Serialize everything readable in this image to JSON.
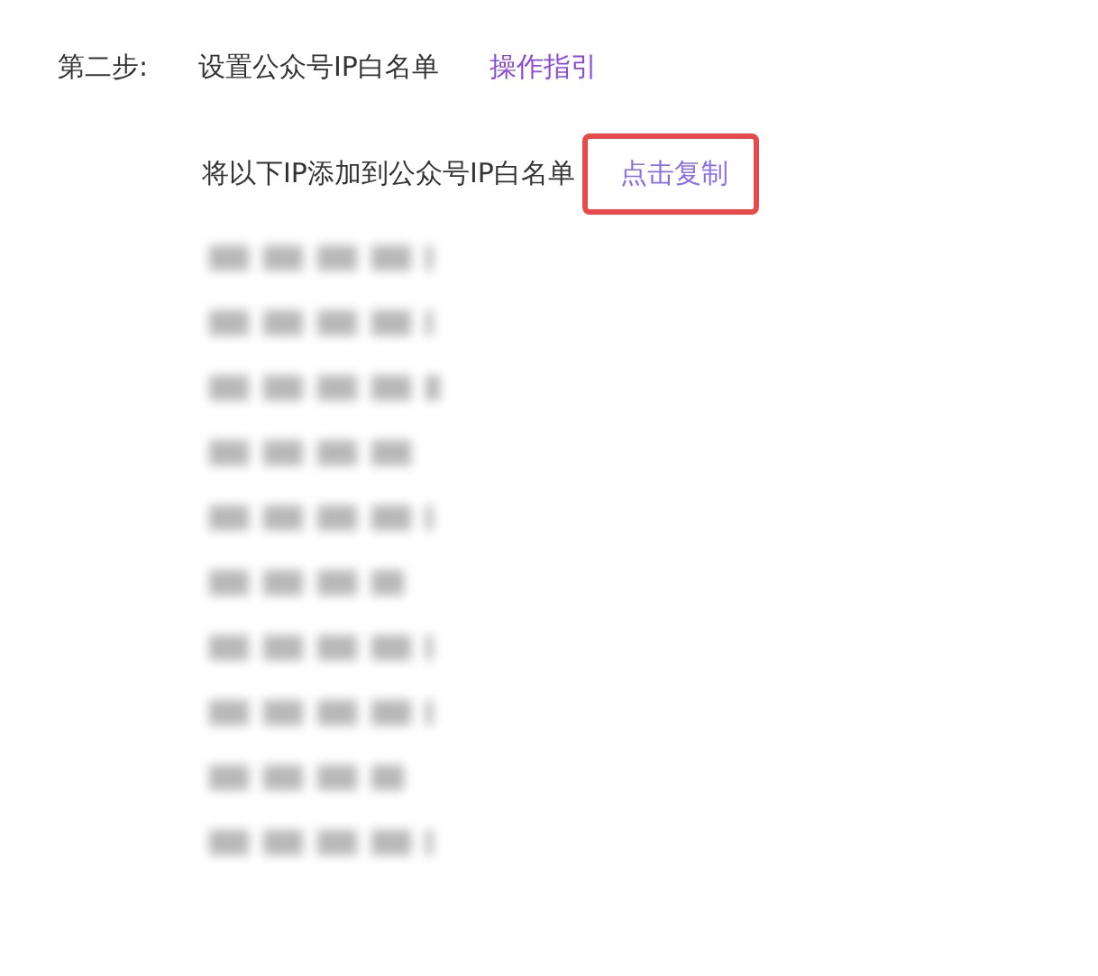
{
  "step": {
    "label": "第二步:",
    "title": "设置公众号IP白名单",
    "guide_link": "操作指引"
  },
  "instruction": {
    "text": "将以下IP添加到公众号IP白名单",
    "copy_link": "点击复制",
    "highlighted": true
  },
  "ip_list": [
    {
      "kind": "blurred"
    },
    {
      "kind": "blurred"
    },
    {
      "kind": "blurred"
    },
    {
      "kind": "blurred"
    },
    {
      "kind": "blurred"
    },
    {
      "kind": "blurred"
    },
    {
      "kind": "blurred"
    },
    {
      "kind": "blurred"
    },
    {
      "kind": "blurred"
    },
    {
      "kind": "blurred"
    }
  ]
}
